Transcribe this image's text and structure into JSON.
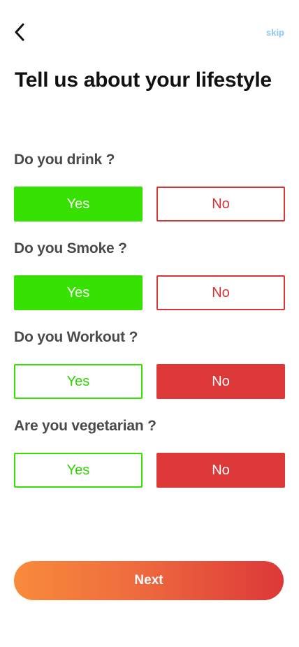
{
  "header": {
    "back_icon": "chevron-left-icon",
    "skip_label": "skip"
  },
  "title": "Tell us about your lifestyle",
  "questions": [
    {
      "label": "Do you drink ?",
      "yes_label": "Yes",
      "no_label": "No",
      "selected": "Yes"
    },
    {
      "label": "Do you Smoke ?",
      "yes_label": "Yes",
      "no_label": "No",
      "selected": "Yes"
    },
    {
      "label": "Do you Workout ?",
      "yes_label": "Yes",
      "no_label": "No",
      "selected": "No"
    },
    {
      "label": "Are you vegetarian ?",
      "yes_label": "Yes",
      "no_label": "No",
      "selected": "No"
    }
  ],
  "next_label": "Next",
  "colors": {
    "yes_green": "#36e000",
    "no_red": "#dc3838",
    "skip_blue": "#8cc6ef",
    "gradient_start": "#f88b3b",
    "gradient_end": "#dc3838"
  }
}
